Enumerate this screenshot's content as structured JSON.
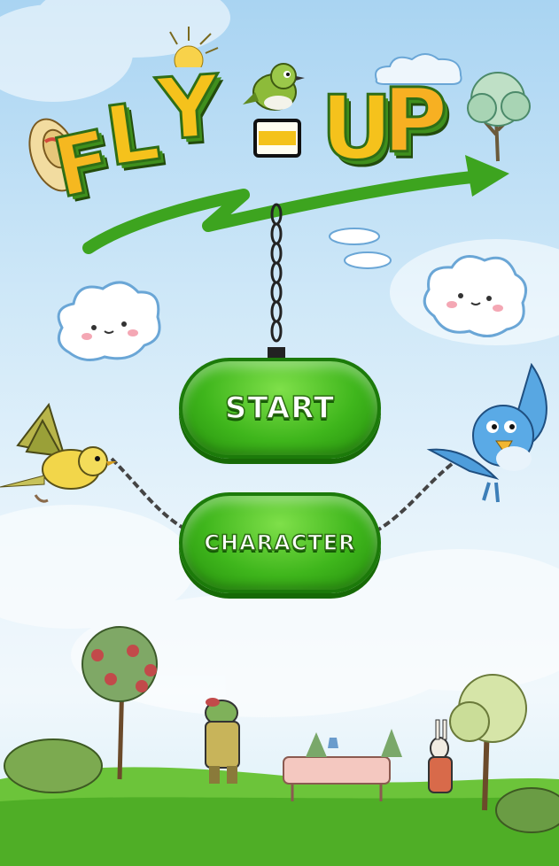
{
  "title": {
    "letters": [
      "F",
      "L",
      "Y",
      "U",
      "P"
    ]
  },
  "menu": {
    "start_label": "START",
    "character_label": "CHARACTER"
  }
}
